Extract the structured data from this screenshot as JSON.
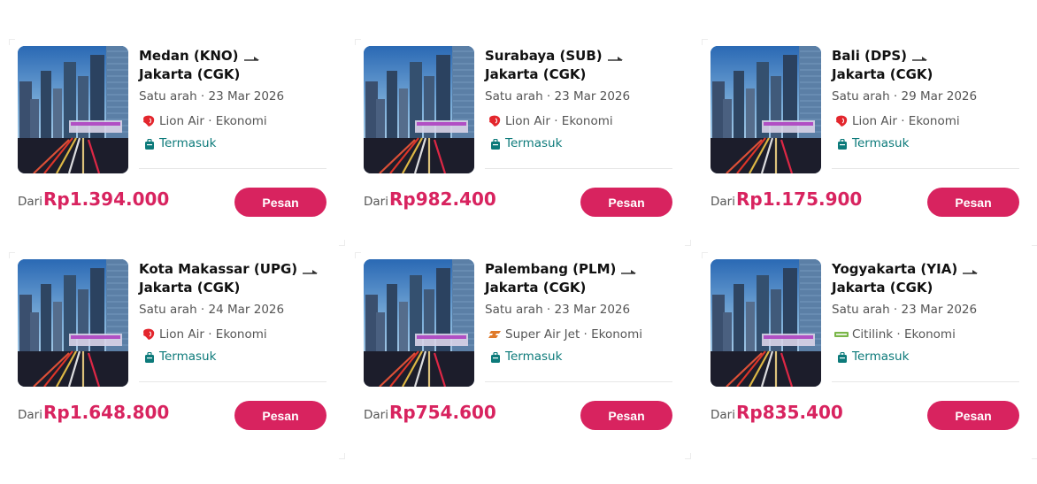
{
  "cards": [
    {
      "from": "Medan (KNO)",
      "to": "Jakarta (CGK)",
      "trip": "Satu arah · 23 Mar 2026",
      "airline": "Lion Air · Ekonomi",
      "airline_icon": "lion-air-logo",
      "baggage": "Termasuk",
      "dari": "Dari",
      "price": "Rp1.394.000",
      "button": "Pesan"
    },
    {
      "from": "Surabaya (SUB)",
      "to": "Jakarta (CGK)",
      "trip": "Satu arah · 23 Mar 2026",
      "airline": "Lion Air · Ekonomi",
      "airline_icon": "lion-air-logo",
      "baggage": "Termasuk",
      "dari": "Dari",
      "price": "Rp982.400",
      "button": "Pesan"
    },
    {
      "from": "Bali (DPS)",
      "to": "Jakarta (CGK)",
      "trip": "Satu arah · 29 Mar 2026",
      "airline": "Lion Air · Ekonomi",
      "airline_icon": "lion-air-logo",
      "baggage": "Termasuk",
      "dari": "Dari",
      "price": "Rp1.175.900",
      "button": "Pesan"
    },
    {
      "from": "Kota Makassar (UPG)",
      "to": "Jakarta (CGK)",
      "trip": "Satu arah · 24 Mar 2026",
      "airline": "Lion Air · Ekonomi",
      "airline_icon": "lion-air-logo",
      "baggage": "Termasuk",
      "dari": "Dari",
      "price": "Rp1.648.800",
      "button": "Pesan"
    },
    {
      "from": "Palembang (PLM)",
      "to": "Jakarta (CGK)",
      "trip": "Satu arah · 23 Mar 2026",
      "airline": "Super Air Jet · Ekonomi",
      "airline_icon": "super-air-jet-logo",
      "baggage": "Termasuk",
      "dari": "Dari",
      "price": "Rp754.600",
      "button": "Pesan"
    },
    {
      "from": "Yogyakarta (YIA)",
      "to": "Jakarta (CGK)",
      "trip": "Satu arah · 23 Mar 2026",
      "airline": "Citilink · Ekonomi",
      "airline_icon": "citilink-logo",
      "baggage": "Termasuk",
      "dari": "Dari",
      "price": "Rp835.400",
      "button": "Pesan"
    }
  ],
  "colors": {
    "accent": "#d8235f",
    "baggage": "#0c7a7a",
    "lion_air": "#e3262d",
    "super_air_jet": "#e07a2a",
    "citilink": "#7ab648"
  }
}
